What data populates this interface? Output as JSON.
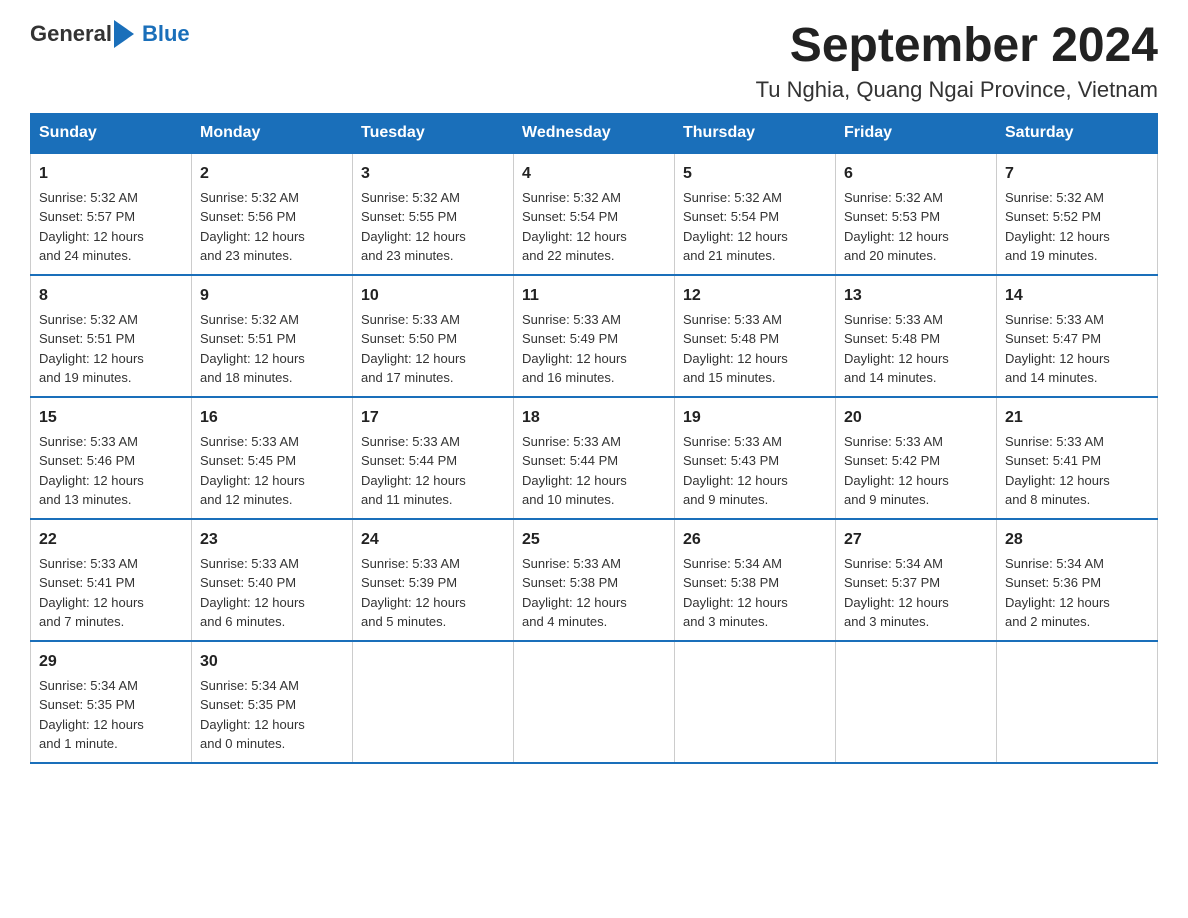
{
  "logo": {
    "general": "General",
    "blue": "Blue"
  },
  "title": {
    "month_year": "September 2024",
    "location": "Tu Nghia, Quang Ngai Province, Vietnam"
  },
  "days_of_week": [
    "Sunday",
    "Monday",
    "Tuesday",
    "Wednesday",
    "Thursday",
    "Friday",
    "Saturday"
  ],
  "weeks": [
    [
      {
        "day": "1",
        "sunrise": "5:32 AM",
        "sunset": "5:57 PM",
        "daylight": "12 hours and 24 minutes."
      },
      {
        "day": "2",
        "sunrise": "5:32 AM",
        "sunset": "5:56 PM",
        "daylight": "12 hours and 23 minutes."
      },
      {
        "day": "3",
        "sunrise": "5:32 AM",
        "sunset": "5:55 PM",
        "daylight": "12 hours and 23 minutes."
      },
      {
        "day": "4",
        "sunrise": "5:32 AM",
        "sunset": "5:54 PM",
        "daylight": "12 hours and 22 minutes."
      },
      {
        "day": "5",
        "sunrise": "5:32 AM",
        "sunset": "5:54 PM",
        "daylight": "12 hours and 21 minutes."
      },
      {
        "day": "6",
        "sunrise": "5:32 AM",
        "sunset": "5:53 PM",
        "daylight": "12 hours and 20 minutes."
      },
      {
        "day": "7",
        "sunrise": "5:32 AM",
        "sunset": "5:52 PM",
        "daylight": "12 hours and 19 minutes."
      }
    ],
    [
      {
        "day": "8",
        "sunrise": "5:32 AM",
        "sunset": "5:51 PM",
        "daylight": "12 hours and 19 minutes."
      },
      {
        "day": "9",
        "sunrise": "5:32 AM",
        "sunset": "5:51 PM",
        "daylight": "12 hours and 18 minutes."
      },
      {
        "day": "10",
        "sunrise": "5:33 AM",
        "sunset": "5:50 PM",
        "daylight": "12 hours and 17 minutes."
      },
      {
        "day": "11",
        "sunrise": "5:33 AM",
        "sunset": "5:49 PM",
        "daylight": "12 hours and 16 minutes."
      },
      {
        "day": "12",
        "sunrise": "5:33 AM",
        "sunset": "5:48 PM",
        "daylight": "12 hours and 15 minutes."
      },
      {
        "day": "13",
        "sunrise": "5:33 AM",
        "sunset": "5:48 PM",
        "daylight": "12 hours and 14 minutes."
      },
      {
        "day": "14",
        "sunrise": "5:33 AM",
        "sunset": "5:47 PM",
        "daylight": "12 hours and 14 minutes."
      }
    ],
    [
      {
        "day": "15",
        "sunrise": "5:33 AM",
        "sunset": "5:46 PM",
        "daylight": "12 hours and 13 minutes."
      },
      {
        "day": "16",
        "sunrise": "5:33 AM",
        "sunset": "5:45 PM",
        "daylight": "12 hours and 12 minutes."
      },
      {
        "day": "17",
        "sunrise": "5:33 AM",
        "sunset": "5:44 PM",
        "daylight": "12 hours and 11 minutes."
      },
      {
        "day": "18",
        "sunrise": "5:33 AM",
        "sunset": "5:44 PM",
        "daylight": "12 hours and 10 minutes."
      },
      {
        "day": "19",
        "sunrise": "5:33 AM",
        "sunset": "5:43 PM",
        "daylight": "12 hours and 9 minutes."
      },
      {
        "day": "20",
        "sunrise": "5:33 AM",
        "sunset": "5:42 PM",
        "daylight": "12 hours and 9 minutes."
      },
      {
        "day": "21",
        "sunrise": "5:33 AM",
        "sunset": "5:41 PM",
        "daylight": "12 hours and 8 minutes."
      }
    ],
    [
      {
        "day": "22",
        "sunrise": "5:33 AM",
        "sunset": "5:41 PM",
        "daylight": "12 hours and 7 minutes."
      },
      {
        "day": "23",
        "sunrise": "5:33 AM",
        "sunset": "5:40 PM",
        "daylight": "12 hours and 6 minutes."
      },
      {
        "day": "24",
        "sunrise": "5:33 AM",
        "sunset": "5:39 PM",
        "daylight": "12 hours and 5 minutes."
      },
      {
        "day": "25",
        "sunrise": "5:33 AM",
        "sunset": "5:38 PM",
        "daylight": "12 hours and 4 minutes."
      },
      {
        "day": "26",
        "sunrise": "5:34 AM",
        "sunset": "5:38 PM",
        "daylight": "12 hours and 3 minutes."
      },
      {
        "day": "27",
        "sunrise": "5:34 AM",
        "sunset": "5:37 PM",
        "daylight": "12 hours and 3 minutes."
      },
      {
        "day": "28",
        "sunrise": "5:34 AM",
        "sunset": "5:36 PM",
        "daylight": "12 hours and 2 minutes."
      }
    ],
    [
      {
        "day": "29",
        "sunrise": "5:34 AM",
        "sunset": "5:35 PM",
        "daylight": "12 hours and 1 minute."
      },
      {
        "day": "30",
        "sunrise": "5:34 AM",
        "sunset": "5:35 PM",
        "daylight": "12 hours and 0 minutes."
      },
      null,
      null,
      null,
      null,
      null
    ]
  ],
  "labels": {
    "sunrise": "Sunrise:",
    "sunset": "Sunset:",
    "daylight": "Daylight:"
  }
}
